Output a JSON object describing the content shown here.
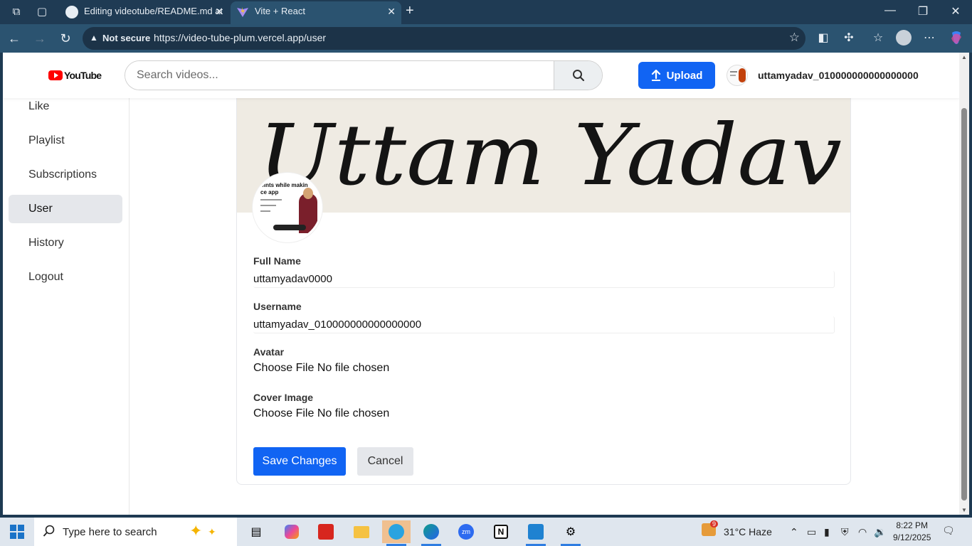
{
  "browser": {
    "tabs": [
      {
        "title": "Editing videotube/README.md at",
        "active": false
      },
      {
        "title": "Vite + React",
        "active": true
      }
    ],
    "security_label": "Not secure",
    "url": "https://video-tube-plum.vercel.app/user"
  },
  "app": {
    "logo_text": "YouTube",
    "search_placeholder": "Search videos...",
    "upload_label": "Upload",
    "username": "uttamyadav_010000000000000000"
  },
  "sidebar": {
    "items": [
      {
        "label": "Like",
        "active": false
      },
      {
        "label": "Playlist",
        "active": false
      },
      {
        "label": "Subscriptions",
        "active": false
      },
      {
        "label": "User",
        "active": true
      },
      {
        "label": "History",
        "active": false
      },
      {
        "label": "Logout",
        "active": false
      }
    ]
  },
  "profile": {
    "cover_text": "Uttam Yadav",
    "avatar_text_1": "oints while makin",
    "avatar_text_2": "ce app",
    "fields": {
      "fullname_label": "Full Name",
      "fullname_value": "uttamyadav0000",
      "username_label": "Username",
      "username_value": "uttamyadav_010000000000000000",
      "avatar_label": "Avatar",
      "avatar_file": "Choose File No file chosen",
      "cover_label": "Cover Image",
      "cover_file": "Choose File No file chosen"
    },
    "save_label": "Save Changes",
    "cancel_label": "Cancel"
  },
  "taskbar": {
    "search_text": "Type here to search",
    "weather": "31°C  Haze",
    "weather_badge": "9",
    "time": "8:22 PM",
    "date": "9/12/2025"
  },
  "colors": {
    "accent": "#1164f3",
    "browser_frame": "#1f3b54",
    "active_nav": "#e5e7eb"
  }
}
